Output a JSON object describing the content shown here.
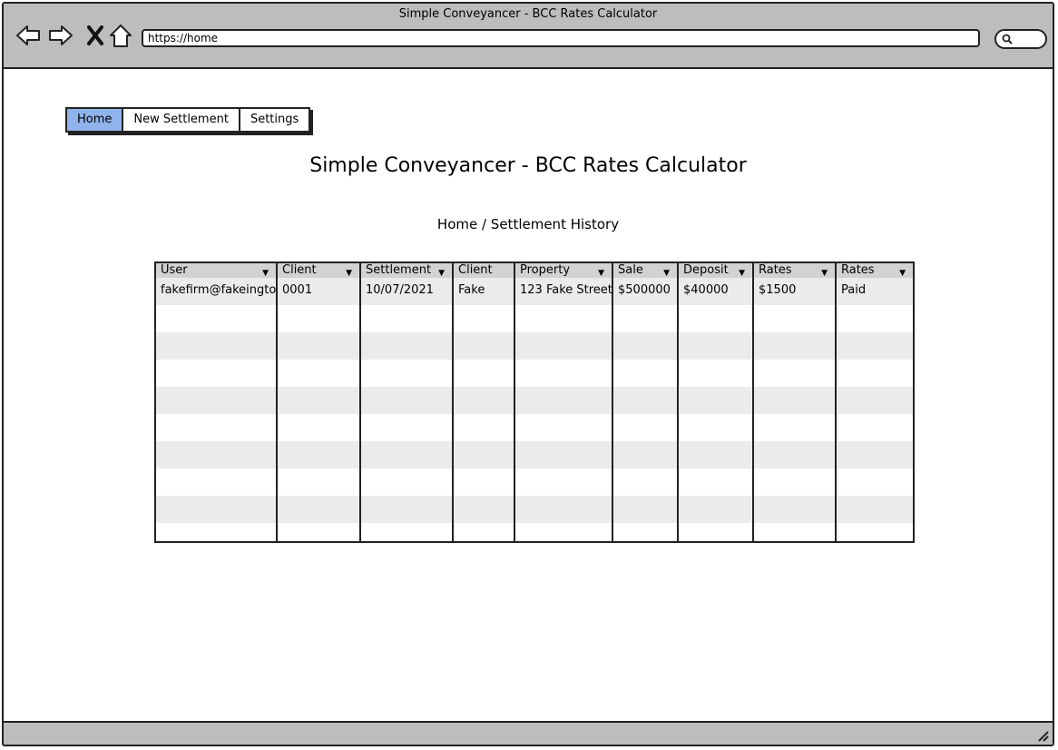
{
  "window": {
    "title": "Simple Conveyancer - BCC Rates Calculator",
    "url": "https://home"
  },
  "tabs": [
    {
      "label": "Home",
      "active": true
    },
    {
      "label": "New Settlement",
      "active": false
    },
    {
      "label": "Settings",
      "active": false
    }
  ],
  "page": {
    "title": "Simple Conveyancer - BCC Rates Calculator",
    "breadcrumb": "Home / Settlement History"
  },
  "table": {
    "columns": [
      "User",
      "Client",
      "Settlement",
      "Client",
      "Property",
      "Sale",
      "Deposit",
      "Rates",
      "Rates"
    ],
    "rows": [
      [
        "fakefirm@fakeington.",
        "0001",
        "10/07/2021",
        "Fake",
        "123 Fake Street",
        "$500000",
        "$40000",
        "$1500",
        "Paid"
      ]
    ]
  },
  "colors": {
    "chrome": "#bdbdbd",
    "active_tab": "#8fb3ea",
    "row_stripe": "#ebebeb",
    "header": "#d2d2d2"
  },
  "icons": [
    "back-icon",
    "forward-icon",
    "close-icon",
    "home-icon",
    "search-icon",
    "resize-grip-icon"
  ]
}
